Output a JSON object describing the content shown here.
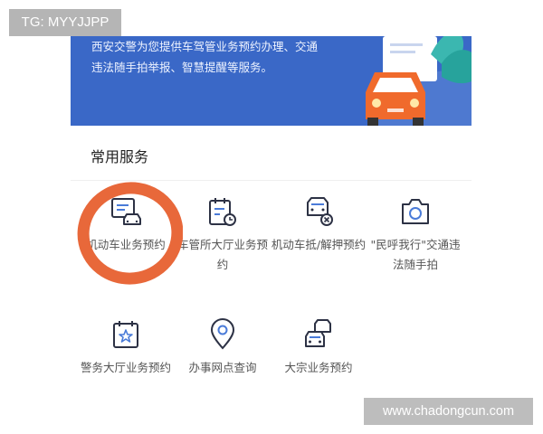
{
  "banner": {
    "text": "西安交警为您提供车驾管业务预约办理、交通违法随手拍举报、智慧提醒等服务。"
  },
  "section": {
    "title": "常用服务"
  },
  "services": [
    {
      "label": "机动车业务预约",
      "icon": "vehicle-card-icon"
    },
    {
      "label": "车管所大厅业务预约",
      "icon": "calendar-clock-icon"
    },
    {
      "label": "机动车抵/解押预约",
      "icon": "car-cancel-icon"
    },
    {
      "label": "\"民呼我行\"交通违法随手拍",
      "icon": "camera-icon"
    },
    {
      "label": "警务大厅业务预约",
      "icon": "calendar-star-icon"
    },
    {
      "label": "办事网点查询",
      "icon": "location-pin-icon"
    },
    {
      "label": "大宗业务预约",
      "icon": "multiple-cars-icon"
    }
  ],
  "overlay": {
    "tg": "TG: MYYJJPP",
    "watermark": "www.chadongcun.com",
    "highlight_color": "#e8683a"
  },
  "colors": {
    "banner": "#3a68c7",
    "icon": "#2d3245",
    "icon_accent": "#4a7bd8"
  }
}
